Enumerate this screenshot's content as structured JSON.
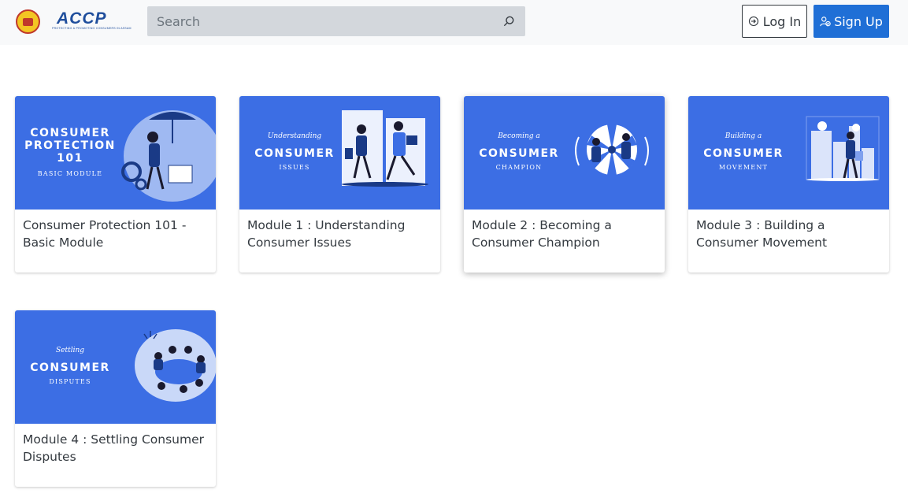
{
  "header": {
    "logo_text": "ACCP",
    "logo_tagline": "PROTECTING & PROMOTING CONSUMERS IN ASSAM",
    "search_placeholder": "Search",
    "login_label": "Log In",
    "signup_label": "Sign Up"
  },
  "colors": {
    "thumb_blue": "#3c6ee4",
    "signup_blue": "#1f6fd6",
    "topbar_bg": "#f8f9fa"
  },
  "courses": [
    {
      "title": "Consumer Protection 101 - Basic Module",
      "thumb_kicker": "",
      "thumb_main": "CONSUMER PROTECTION 101",
      "thumb_sub": "BASIC MODULE"
    },
    {
      "title": "Module 1 : Understanding Consumer Issues",
      "thumb_kicker": "Understanding",
      "thumb_main": "CONSUMER",
      "thumb_sub": "ISSUES"
    },
    {
      "title": "Module 2 : Becoming a Consumer Champion",
      "thumb_kicker": "Becoming a",
      "thumb_main": "CONSUMER",
      "thumb_sub": "CHAMPION"
    },
    {
      "title": "Module 3 : Building a Consumer Movement",
      "thumb_kicker": "Building a",
      "thumb_main": "CONSUMER",
      "thumb_sub": "MOVEMENT"
    },
    {
      "title": "Module 4 : Settling Consumer Disputes",
      "thumb_kicker": "Settling",
      "thumb_main": "CONSUMER",
      "thumb_sub": "DISPUTES"
    }
  ]
}
